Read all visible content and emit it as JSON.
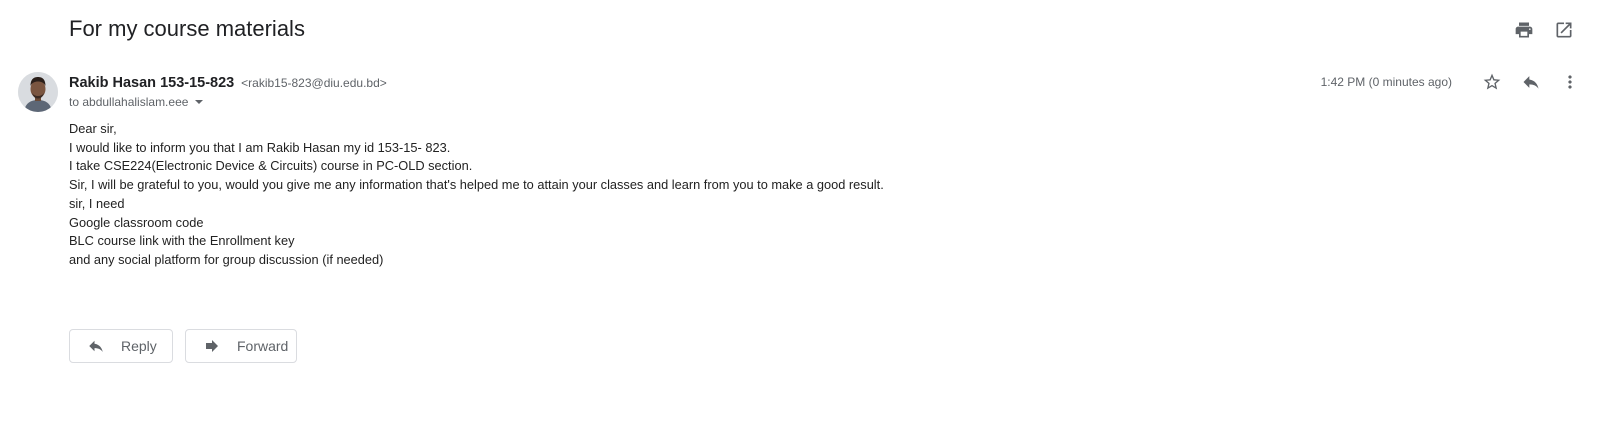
{
  "email": {
    "subject": "For my course materials",
    "sender": {
      "name": "Rakib Hasan 153-15-823",
      "email": "<rakib15-823@diu.edu.bd>"
    },
    "recipient": "to abdullahalislam.eee",
    "timestamp": "1:42 PM (0 minutes ago)",
    "body_lines": [
      "Dear sir,",
      "I would like to inform you that I am Rakib Hasan my id 153-15- 823.",
      "I take CSE224(Electronic Device & Circuits) course in PC-OLD section.",
      "Sir, I will be grateful to you, would you give me any information that's helped me to attain your classes and learn from you to make a good result.",
      "sir, I need",
      "Google classroom code",
      "BLC course link with the Enrollment key",
      "and any social platform for group discussion (if needed)"
    ]
  },
  "actions": {
    "reply_label": "Reply",
    "forward_label": "Forward"
  },
  "icons": {
    "print": "print-icon",
    "open_new_window": "open-in-new-window-icon",
    "star": "star-icon",
    "reply": "reply-icon",
    "more": "more-vert-icon",
    "caret": "caret-down-icon",
    "forward": "forward-icon"
  },
  "colors": {
    "text_primary": "#202124",
    "text_secondary": "#5f6368",
    "icon": "#5f6368",
    "button_border": "#dadce0"
  }
}
